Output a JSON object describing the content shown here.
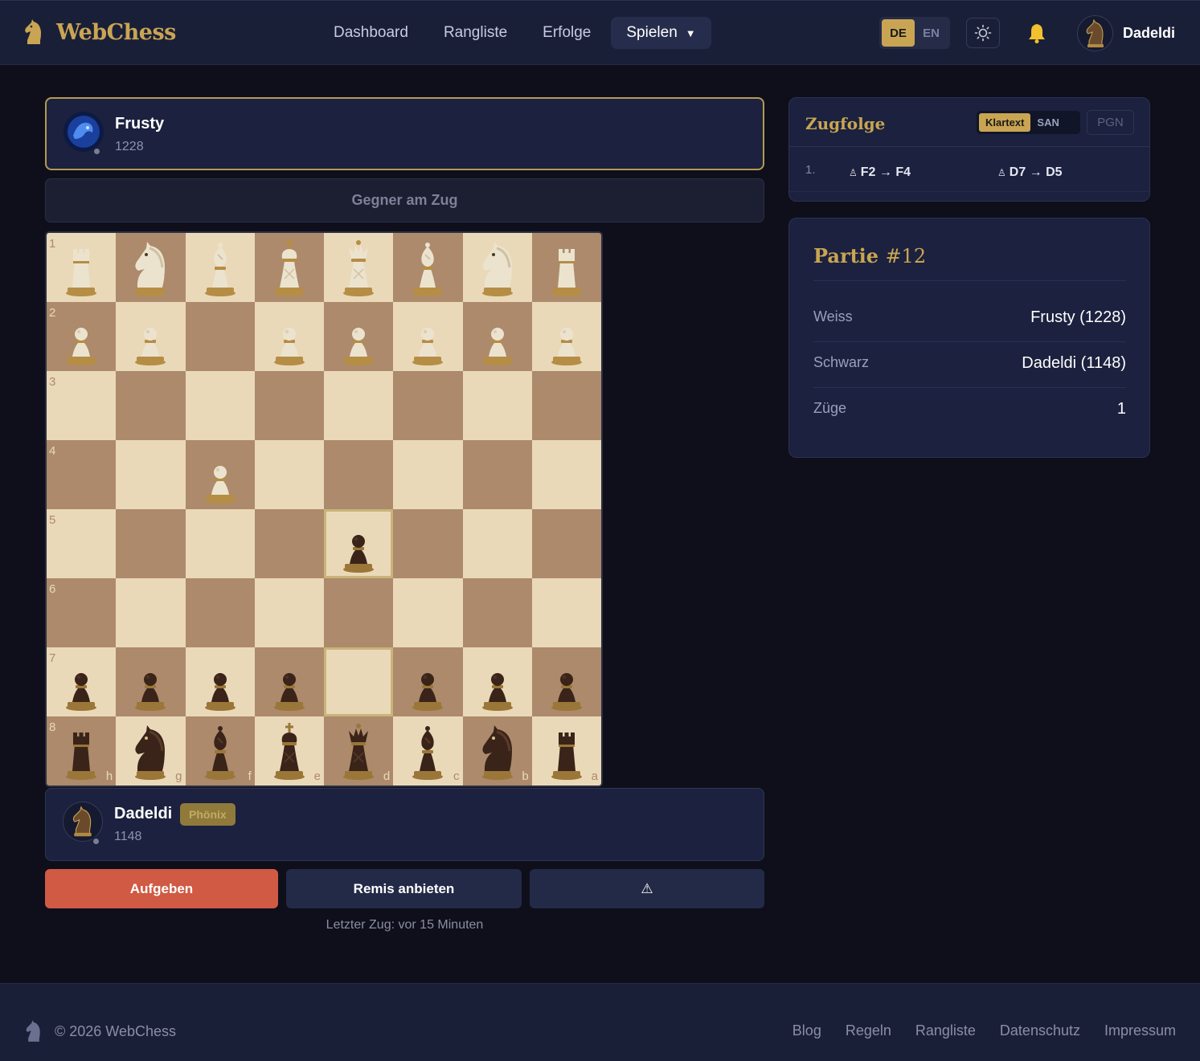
{
  "header": {
    "brand": "WebChess",
    "nav": [
      {
        "label": "Dashboard"
      },
      {
        "label": "Rangliste"
      },
      {
        "label": "Erfolge"
      }
    ],
    "play_label": "Spielen",
    "play_caret": "▼",
    "lang": {
      "de": "DE",
      "en": "EN",
      "active": "DE"
    },
    "user_name": "Dadeldi"
  },
  "opponent": {
    "name": "Frusty",
    "rating": "1228"
  },
  "turn_status": "Gegner am Zug",
  "me": {
    "name": "Dadeldi",
    "rating": "1148",
    "badge": "Phönix"
  },
  "board": {
    "ranks": [
      "1",
      "2",
      "3",
      "4",
      "5",
      "6",
      "7",
      "8"
    ],
    "files": [
      "h",
      "g",
      "f",
      "e",
      "d",
      "c",
      "b",
      "a"
    ],
    "rows": [
      [
        "wR",
        "wN",
        "wB",
        "wK",
        "wQ",
        "wB",
        "wN",
        "wR"
      ],
      [
        "wP",
        "wP",
        "",
        "wP",
        "wP",
        "wP",
        "wP",
        "wP"
      ],
      [
        "",
        "",
        "",
        "",
        "",
        "",
        "",
        ""
      ],
      [
        "",
        "",
        "wP",
        "",
        "",
        "",
        "",
        ""
      ],
      [
        "",
        "",
        "",
        "",
        "bP",
        "",
        "",
        ""
      ],
      [
        "",
        "",
        "",
        "",
        "",
        "",
        "",
        ""
      ],
      [
        "bP",
        "bP",
        "bP",
        "bP",
        "",
        "bP",
        "bP",
        "bP"
      ],
      [
        "bR",
        "bN",
        "bB",
        "bK",
        "bQ",
        "bB",
        "bN",
        "bR"
      ]
    ],
    "highlight": [
      [
        4,
        4
      ],
      [
        6,
        4
      ]
    ],
    "light_color": "#ead9b8",
    "dark_color": "#ad8a6b"
  },
  "actions": {
    "resign": "Aufgeben",
    "draw": "Remis anbieten",
    "report": "⚠"
  },
  "last_move": "Letzter Zug: vor 15 Minuten",
  "moves_panel": {
    "title": "Zugfolge",
    "toggle": [
      "Klartext",
      "SAN"
    ],
    "toggle_active": "Klartext",
    "pgn": "PGN",
    "moves": [
      {
        "num": "1.",
        "white_icon": "♙",
        "white": "F2 → F4",
        "black_icon": "♙",
        "black": "D7 → D5"
      }
    ]
  },
  "game_panel": {
    "title": "Partie",
    "number": "#12",
    "rows": [
      {
        "key": "Weiss",
        "value": "Frusty (1228)"
      },
      {
        "key": "Schwarz",
        "value": "Dadeldi (1148)"
      },
      {
        "key": "Züge",
        "value": "1"
      }
    ]
  },
  "footer": {
    "copy": "© 2026 WebChess",
    "links": [
      "Blog",
      "Regeln",
      "Rangliste",
      "Datenschutz",
      "Impressum"
    ]
  },
  "colors": {
    "accent": "#c9a553",
    "resign": "#d05a44",
    "background": "#0e0f1a",
    "panel": "#1b213e"
  }
}
